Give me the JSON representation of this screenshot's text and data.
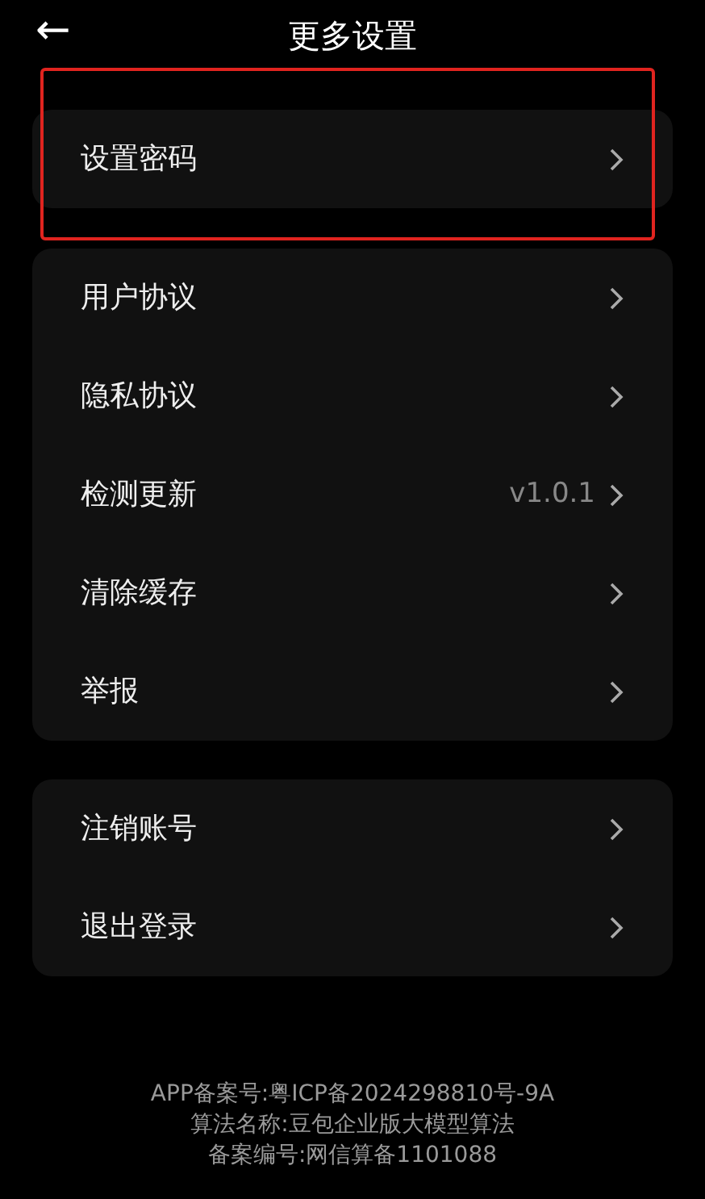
{
  "header": {
    "back": "←",
    "title": "更多设置"
  },
  "groups": [
    {
      "highlighted": true,
      "items": [
        {
          "label": "设置密码"
        }
      ]
    },
    {
      "highlighted": false,
      "items": [
        {
          "label": "用户协议"
        },
        {
          "label": "隐私协议"
        },
        {
          "label": "检测更新",
          "value": "v1.0.1"
        },
        {
          "label": "清除缓存"
        },
        {
          "label": "举报"
        }
      ]
    },
    {
      "highlighted": false,
      "items": [
        {
          "label": "注销账号"
        },
        {
          "label": "退出登录"
        }
      ]
    }
  ],
  "footer": [
    "APP备案号:粤ICP备2024298810号-9A",
    "算法名称:豆包企业版大模型算法",
    "备案编号:网信算备1101088"
  ]
}
